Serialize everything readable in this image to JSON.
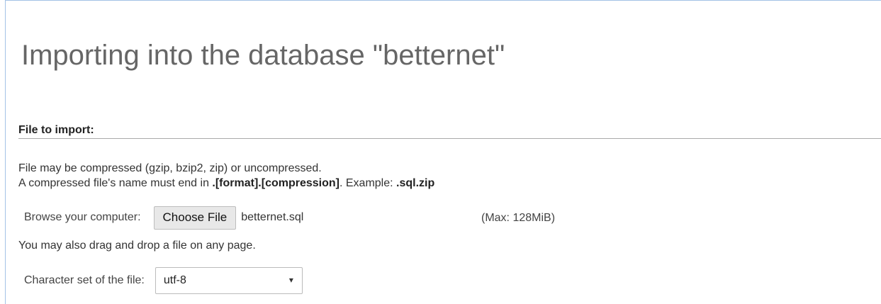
{
  "page": {
    "title": "Importing into the database \"betternet\""
  },
  "import_section": {
    "header": "File to import:",
    "note_line1": "File may be compressed (gzip, bzip2, zip) or uncompressed.",
    "note_line2_prefix": "A compressed file's name must end in ",
    "note_line2_bold": ".[format].[compression]",
    "note_line2_middle": ". Example: ",
    "note_line2_example": ".sql.zip",
    "browse_label": "Browse your computer:",
    "choose_file_label": "Choose File",
    "selected_file": "betternet.sql",
    "max_size": "(Max: 128MiB)",
    "drag_note": "You may also drag and drop a file on any page.",
    "charset_label": "Character set of the file:",
    "charset_value": "utf-8",
    "charset_caret_icon": "▾"
  },
  "colors": {
    "frame_border": "#a3c2e6",
    "title_text": "#666666",
    "button_bg": "#e8e8e8"
  }
}
